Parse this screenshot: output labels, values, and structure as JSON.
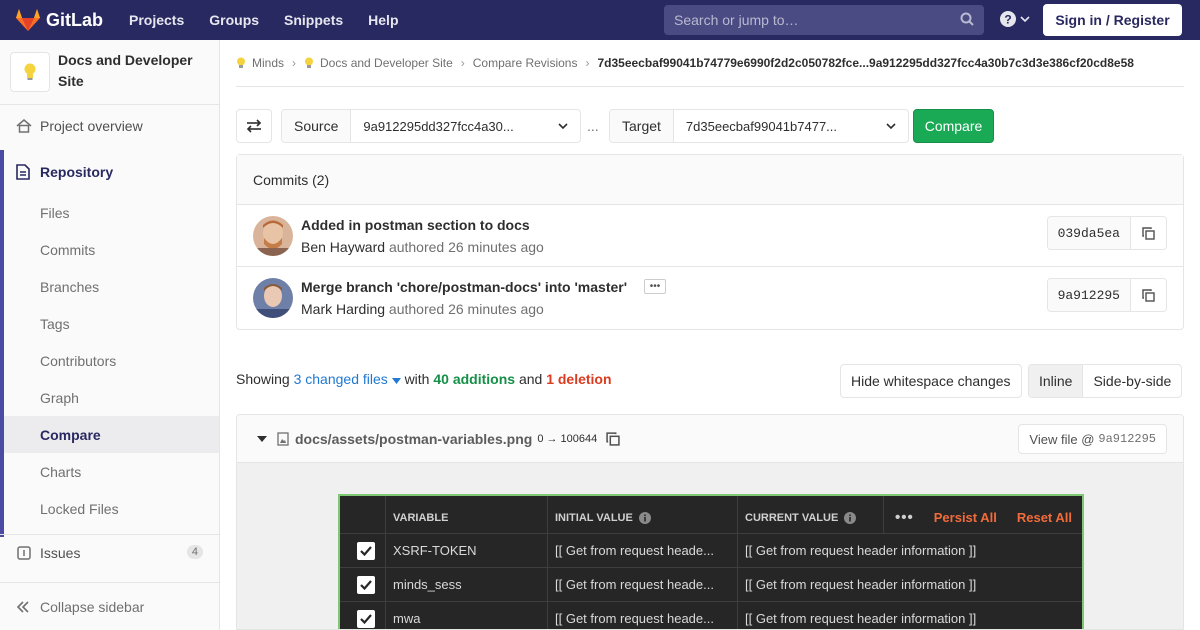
{
  "navbar": {
    "brand": "GitLab",
    "links": [
      "Projects",
      "Groups",
      "Snippets",
      "Help"
    ],
    "search_placeholder": "Search or jump to…",
    "signin": "Sign in / Register"
  },
  "sidebar": {
    "project_name": "Docs and Developer Site",
    "overview": "Project overview",
    "repository": "Repository",
    "repo_items": [
      "Files",
      "Commits",
      "Branches",
      "Tags",
      "Contributors",
      "Graph",
      "Compare",
      "Charts",
      "Locked Files"
    ],
    "active_item": "Compare",
    "issues": "Issues",
    "issues_count": "4",
    "collapse": "Collapse sidebar"
  },
  "breadcrumbs": {
    "group": "Minds",
    "project": "Docs and Developer Site",
    "section": "Compare Revisions",
    "current": "7d35eecbaf99041b74779e6990f2d2c050782fce...9a912295dd327fcc4a30b7c3d3e386cf20cd8e58"
  },
  "compare": {
    "source_label": "Source",
    "source_value": "9a912295dd327fcc4a30...",
    "separator": "...",
    "target_label": "Target",
    "target_value": "7d35eecbaf99041b7477...",
    "button": "Compare"
  },
  "commits": {
    "header": "Commits (2)",
    "items": [
      {
        "title": "Added in postman section to docs",
        "author": "Ben Hayward",
        "meta": "authored 26 minutes ago",
        "sha": "039da5ea"
      },
      {
        "title": "Merge branch 'chore/postman-docs' into 'master'",
        "author": "Mark Harding",
        "meta": "authored 26 minutes ago",
        "sha": "9a912295"
      }
    ]
  },
  "stats": {
    "showing": "Showing",
    "changed": "3 changed files",
    "with": "with",
    "additions": "40 additions",
    "and": "and",
    "deletions": "1 deletion"
  },
  "controls": {
    "whitespace": "Hide whitespace changes",
    "inline": "Inline",
    "side_by_side": "Side-by-side"
  },
  "file": {
    "path": "docs/assets/postman-variables.png",
    "mode": "0 → 100644",
    "view_label": "View file @",
    "view_sha": "9a912295"
  },
  "postman": {
    "headers": [
      "VARIABLE",
      "INITIAL VALUE",
      "CURRENT VALUE"
    ],
    "persist": "Persist All",
    "reset": "Reset All",
    "rows": [
      {
        "variable": "XSRF-TOKEN",
        "initial": "[[ Get from request heade...",
        "current": "[[ Get from request header information ]]"
      },
      {
        "variable": "minds_sess",
        "initial": "[[ Get from request heade...",
        "current": "[[ Get from request header information ]]"
      },
      {
        "variable": "mwa",
        "initial": "[[ Get from request heade...",
        "current": "[[ Get from request header information ]]"
      }
    ]
  }
}
